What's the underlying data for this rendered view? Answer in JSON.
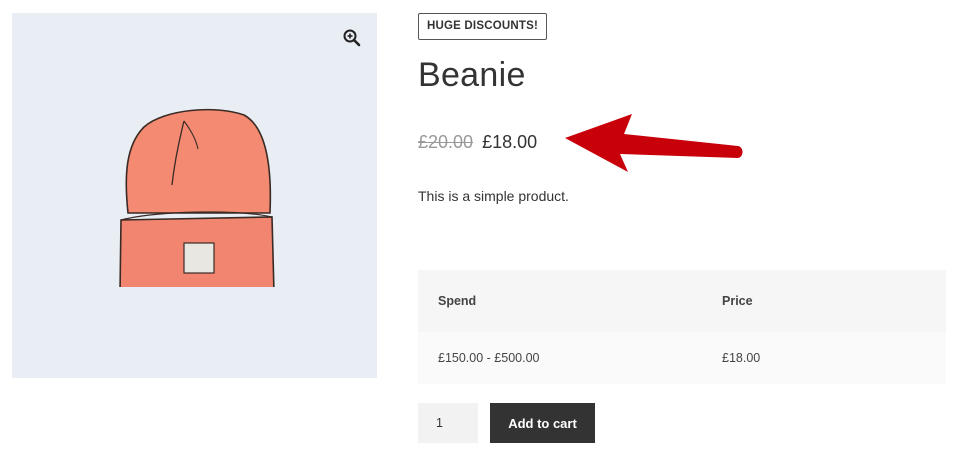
{
  "gallery": {
    "zoom_icon": "magnifier-plus-icon",
    "image_subject": "beanie",
    "background_color": "#e8eef3"
  },
  "product": {
    "badge": "HUGE DISCOUNTS!",
    "title": "Beanie",
    "price_regular": "£20.00",
    "price_sale": "£18.00",
    "description": "This is a simple product."
  },
  "annotation": {
    "arrow_color": "#c8000a"
  },
  "tier_table": {
    "headers": [
      "Spend",
      "Price"
    ],
    "rows": [
      [
        "£150.00 - £500.00",
        "£18.00"
      ]
    ]
  },
  "cart": {
    "quantity": "1",
    "add_label": "Add to cart",
    "button_color": "#333333"
  }
}
